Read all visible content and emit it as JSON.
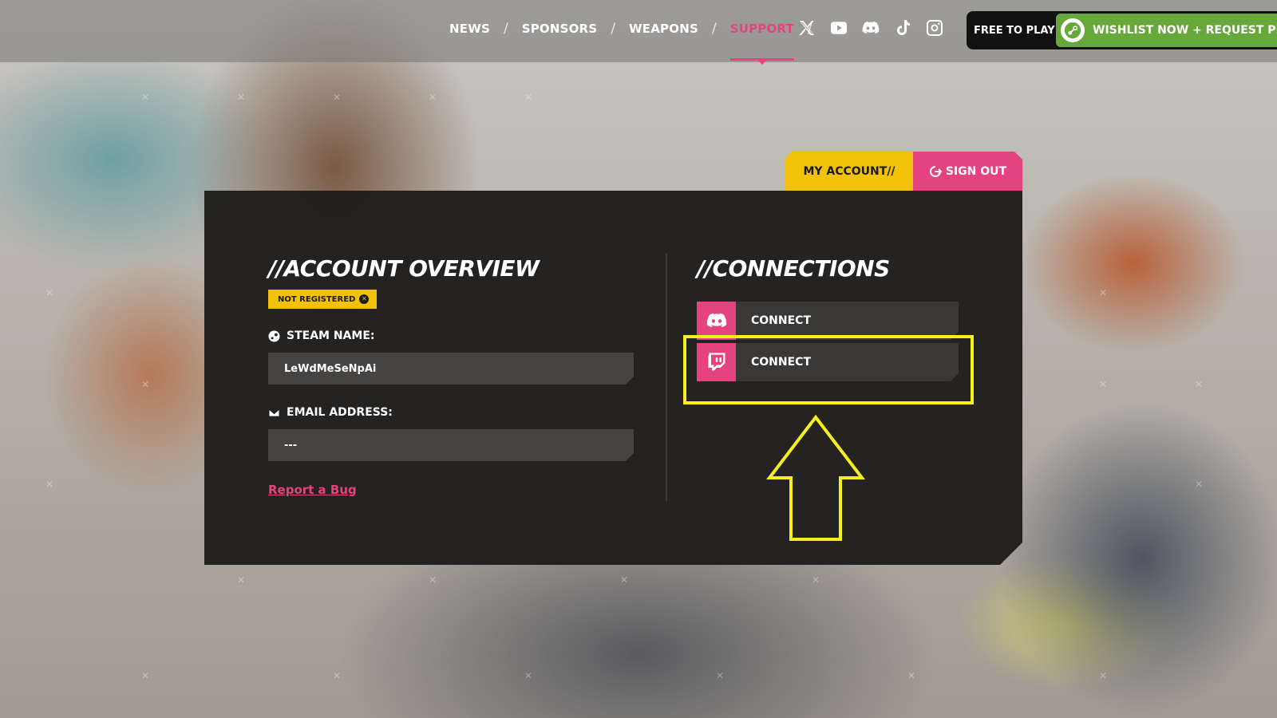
{
  "nav": {
    "items": [
      "NEWS",
      "SPONSORS",
      "WEAPONS",
      "SUPPORT"
    ],
    "active": "SUPPORT",
    "separator": "/",
    "socials": [
      "x-icon",
      "youtube-icon",
      "discord-icon",
      "tiktok-icon",
      "instagram-icon"
    ]
  },
  "cta": {
    "free_label": "FREE TO PLAY",
    "wishlist_label": "WISHLIST NOW + REQUEST PL"
  },
  "account_tabs": {
    "my_account": "MY ACCOUNT//",
    "sign_out": "SIGN OUT"
  },
  "overview": {
    "heading": "//ACCOUNT OVERVIEW",
    "status_badge": "NOT REGISTERED",
    "steam_label": "STEAM NAME:",
    "steam_value": "LeWdMeSeNpAi",
    "email_label": "EMAIL ADDRESS:",
    "email_value": "---",
    "report_bug": "Report a Bug"
  },
  "connections": {
    "heading": "//CONNECTIONS",
    "items": [
      {
        "service": "discord-icon",
        "label": "CONNECT"
      },
      {
        "service": "twitch-icon",
        "label": "CONNECT"
      }
    ]
  },
  "colors": {
    "accent_pink": "#e5437f",
    "accent_yellow": "#f2c20a",
    "steam_green": "#67a83a",
    "annotation_yellow": "#f5ef1e"
  }
}
